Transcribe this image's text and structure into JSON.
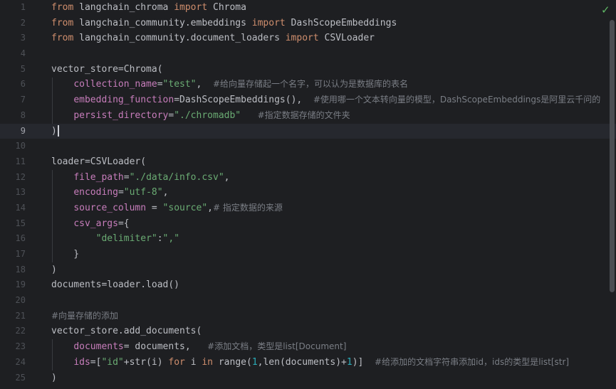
{
  "editor": {
    "status_icon": "check-icon",
    "colors": {
      "background": "#1e1f22",
      "keyword": "#cf8e6d",
      "string": "#6aab73",
      "parameter": "#c77dbb",
      "number": "#2aacb8",
      "comment": "#7a7e85",
      "text": "#bcbec4",
      "line_number": "#4e5157"
    },
    "current_line": 9,
    "lines": [
      {
        "num": "1",
        "tokens": [
          [
            "kw",
            "from"
          ],
          [
            "t",
            " langchain_chroma "
          ],
          [
            "kw",
            "import"
          ],
          [
            "t",
            " Chroma"
          ]
        ]
      },
      {
        "num": "2",
        "tokens": [
          [
            "kw",
            "from"
          ],
          [
            "t",
            " langchain_community.embeddings "
          ],
          [
            "kw",
            "import"
          ],
          [
            "t",
            " DashScopeEmbeddings"
          ]
        ]
      },
      {
        "num": "3",
        "tokens": [
          [
            "kw",
            "from"
          ],
          [
            "t",
            " langchain_community.document_loaders "
          ],
          [
            "kw",
            "import"
          ],
          [
            "t",
            " CSVLoader"
          ]
        ]
      },
      {
        "num": "4",
        "tokens": []
      },
      {
        "num": "5",
        "tokens": [
          [
            "t",
            "vector_store=Chroma("
          ]
        ]
      },
      {
        "num": "6",
        "tokens": [
          [
            "t",
            "    "
          ],
          [
            "param",
            "collection_name"
          ],
          [
            "t",
            "="
          ],
          [
            "str",
            "\"test\""
          ],
          [
            "t",
            ",  "
          ],
          [
            "cmt",
            "#给向量存储起一个名字，可以认为是数据库的表名"
          ]
        ]
      },
      {
        "num": "7",
        "tokens": [
          [
            "t",
            "    "
          ],
          [
            "param",
            "embedding_function"
          ],
          [
            "t",
            "=DashScopeEmbeddings(),  "
          ],
          [
            "cmt",
            "#使用哪一个文本转向量的模型，DashScopeEmbeddings是阿里云千问的"
          ]
        ]
      },
      {
        "num": "8",
        "tokens": [
          [
            "t",
            "    "
          ],
          [
            "param",
            "persist_directory"
          ],
          [
            "t",
            "="
          ],
          [
            "str",
            "\"./chromadb\""
          ],
          [
            "t",
            "   "
          ],
          [
            "cmt",
            "#指定数据存储的文件夹"
          ]
        ]
      },
      {
        "num": "9",
        "tokens": [
          [
            "t",
            ")"
          ]
        ],
        "caret": true
      },
      {
        "num": "10",
        "tokens": []
      },
      {
        "num": "11",
        "tokens": [
          [
            "t",
            "loader=CSVLoader("
          ]
        ]
      },
      {
        "num": "12",
        "tokens": [
          [
            "t",
            "    "
          ],
          [
            "param",
            "file_path"
          ],
          [
            "t",
            "="
          ],
          [
            "str",
            "\"./data/info.csv\""
          ],
          [
            "t",
            ","
          ]
        ]
      },
      {
        "num": "13",
        "tokens": [
          [
            "t",
            "    "
          ],
          [
            "param",
            "encoding"
          ],
          [
            "t",
            "="
          ],
          [
            "str",
            "\"utf-8\""
          ],
          [
            "t",
            ","
          ]
        ]
      },
      {
        "num": "14",
        "tokens": [
          [
            "t",
            "    "
          ],
          [
            "param",
            "source_column"
          ],
          [
            "t",
            " = "
          ],
          [
            "str",
            "\"source\""
          ],
          [
            "t",
            ","
          ],
          [
            "cmt",
            "# 指定数据的来源"
          ]
        ]
      },
      {
        "num": "15",
        "tokens": [
          [
            "t",
            "    "
          ],
          [
            "param",
            "csv_args"
          ],
          [
            "t",
            "={"
          ]
        ]
      },
      {
        "num": "16",
        "tokens": [
          [
            "t",
            "        "
          ],
          [
            "str",
            "\"delimiter\""
          ],
          [
            "t",
            ":"
          ],
          [
            "str",
            "\",\""
          ]
        ]
      },
      {
        "num": "17",
        "tokens": [
          [
            "t",
            "    }"
          ]
        ]
      },
      {
        "num": "18",
        "tokens": [
          [
            "t",
            ")"
          ]
        ]
      },
      {
        "num": "19",
        "tokens": [
          [
            "t",
            "documents=loader.load()"
          ]
        ]
      },
      {
        "num": "20",
        "tokens": []
      },
      {
        "num": "21",
        "tokens": [
          [
            "cmt",
            "#向量存储的添加"
          ]
        ]
      },
      {
        "num": "22",
        "tokens": [
          [
            "t",
            "vector_store.add_documents("
          ]
        ]
      },
      {
        "num": "23",
        "tokens": [
          [
            "t",
            "    "
          ],
          [
            "param",
            "documents"
          ],
          [
            "t",
            "= documents,   "
          ],
          [
            "cmt",
            "#添加文档，类型是list[Document]"
          ]
        ]
      },
      {
        "num": "24",
        "tokens": [
          [
            "t",
            "    "
          ],
          [
            "param",
            "ids"
          ],
          [
            "t",
            "=["
          ],
          [
            "str",
            "\"id\""
          ],
          [
            "t",
            "+str(i) "
          ],
          [
            "kw",
            "for"
          ],
          [
            "t",
            " i "
          ],
          [
            "kw",
            "in"
          ],
          [
            "t",
            " range("
          ],
          [
            "num",
            "1"
          ],
          [
            "t",
            ",len(documents)+"
          ],
          [
            "num",
            "1"
          ],
          [
            "t",
            ")]  "
          ],
          [
            "cmt",
            "#给添加的文档字符串添加id，ids的类型是list[str]"
          ]
        ]
      },
      {
        "num": "25",
        "tokens": [
          [
            "t",
            ")"
          ]
        ]
      }
    ]
  }
}
